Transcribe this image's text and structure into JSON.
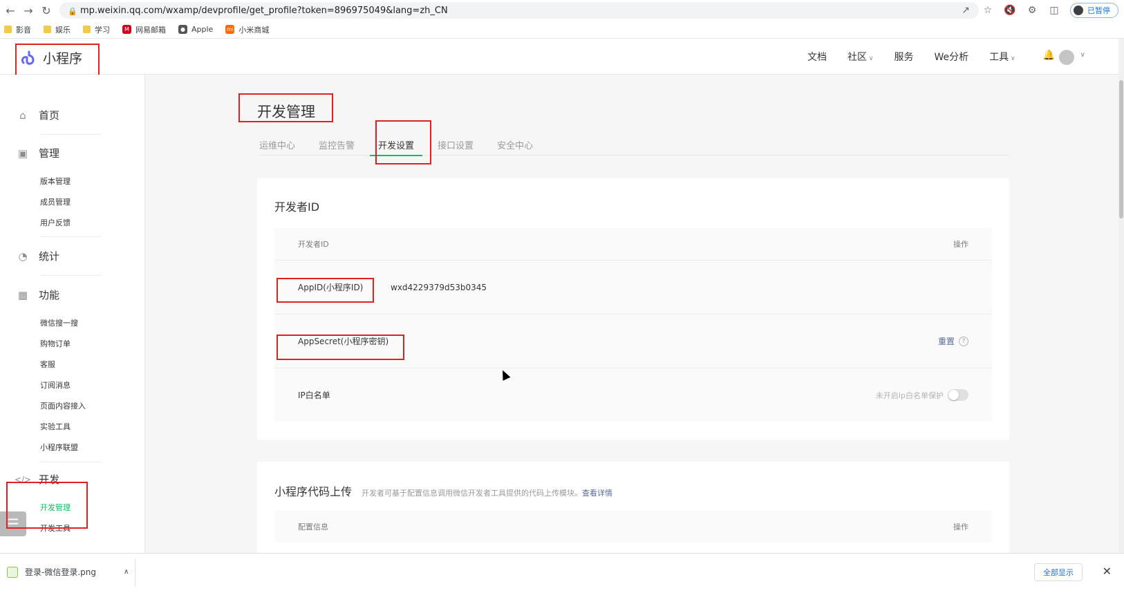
{
  "browser": {
    "url": "mp.weixin.qq.com/wxamp/devprofile/get_profile?token=896975049&lang=zh_CN",
    "profile_label": "已暂停",
    "bookmarks": [
      "影音",
      "娱乐",
      "学习",
      "网易邮箱",
      "Apple",
      "小米商城"
    ]
  },
  "header": {
    "logo_text": "小程序",
    "nav": [
      "文档",
      "社区",
      "服务",
      "We分析",
      "工具"
    ]
  },
  "sidebar": {
    "groups": {
      "home": "首页",
      "manage": "管理",
      "stats": "统计",
      "features": "功能",
      "dev": "开发"
    },
    "manage_items": [
      "版本管理",
      "成员管理",
      "用户反馈"
    ],
    "feature_items": [
      "微信搜一搜",
      "购物订单",
      "客服",
      "订阅消息",
      "页面内容接入",
      "实验工具",
      "小程序联盟"
    ],
    "dev_items": [
      "开发管理",
      "开发工具"
    ]
  },
  "page": {
    "title": "开发管理",
    "tabs": [
      "运维中心",
      "监控告警",
      "开发设置",
      "接口设置",
      "安全中心"
    ]
  },
  "dev_id_card": {
    "title": "开发者ID",
    "col_name": "开发者ID",
    "col_action": "操作",
    "appid_label": "AppID(小程序ID)",
    "appid_value": "wxd4229379d53b0345",
    "secret_label": "AppSecret(小程序密钥)",
    "secret_action": "重置",
    "ip_label": "IP白名单",
    "ip_hint": "未开启Ip白名单保护"
  },
  "upload_card": {
    "title": "小程序代码上传",
    "desc": "开发者可基于配置信息调用微信开发者工具提供的代码上传模块。",
    "desc_link": "查看详情",
    "col_name": "配置信息",
    "col_action": "操作"
  },
  "download_bar": {
    "filename": "登录-微信登录.png",
    "show_all": "全部显示"
  },
  "colors": {
    "accent_green": "#07c160",
    "highlight_red": "#e02020",
    "link_blue": "#576b95"
  }
}
